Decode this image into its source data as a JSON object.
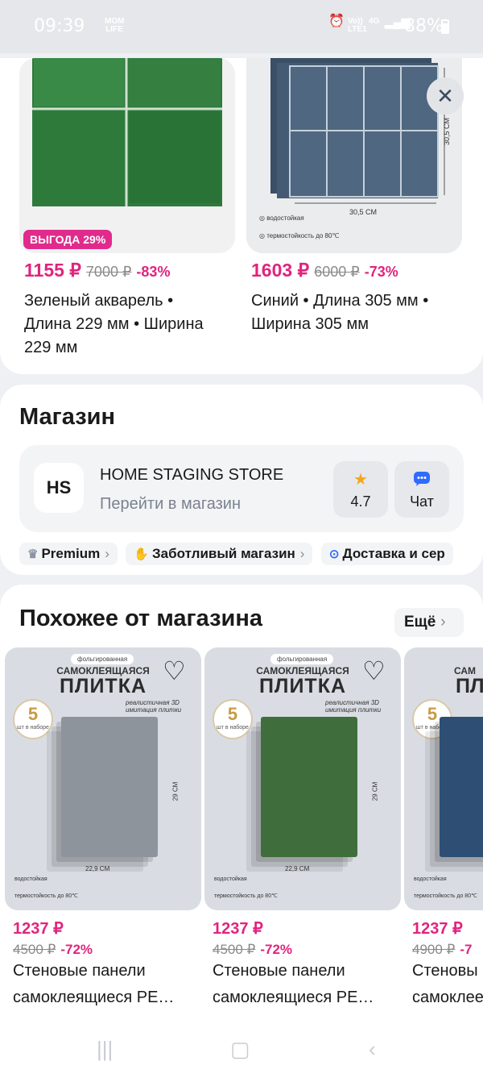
{
  "status_bar": {
    "time": "09:39",
    "carrier_logo": "MOM LIFE",
    "net1": "Vo)) LTE1",
    "net2": "4G",
    "battery": "88%"
  },
  "colors": {
    "accent": "#e0247e",
    "badge": "#e02b8c"
  },
  "products_top": [
    {
      "badge": "ВЫГОДА 29%",
      "price": "1155 ₽",
      "old_price": "7000 ₽",
      "discount": "-83%",
      "line1": "Зеленый акварель •",
      "line2": "Длина 229 мм • Ширина",
      "line3": "229 мм"
    },
    {
      "price": "1603 ₽",
      "old_price": "6000 ₽",
      "discount": "-73%",
      "line1": "Синий • Длина 305 мм •",
      "line2": "Ширина 305 мм",
      "dim_w": "30,5 CM",
      "dim_h": "30,5 CM",
      "feat1": "водостойкая",
      "feat2": "термостойкость до 80℃"
    }
  ],
  "shop": {
    "title": "Магазин",
    "logo": "HS",
    "name": "HOME STAGING STORE",
    "link": "Перейти в магазин",
    "rating": "4.7",
    "chat": "Чат",
    "chips": [
      "Premium",
      "Заботливый магазин",
      "Доставка и сер"
    ]
  },
  "similar": {
    "title": "Похожее от магазина",
    "more": "Ещё",
    "tiles": [
      {
        "tag": "фольгированная",
        "t1": "САМОКЛЕЯЩАЯСЯ",
        "t2": "ПЛИТКА",
        "count": "5",
        "count_unit": "шт в наборе",
        "note": "реалистичная 3D имитация плитки",
        "dim_w": "22,9 CM",
        "dim_h": "29 CM",
        "feat1": "водостойкая",
        "feat2": "термостойкость до 80℃",
        "price": "1237 ₽",
        "old_price": "4500 ₽",
        "discount": "-72%",
        "name1": "Стеновые панели",
        "name2": "самоклеящиеся PE…",
        "panel_color": "#8d949c"
      },
      {
        "tag": "фольгированная",
        "t1": "САМОКЛЕЯЩАЯСЯ",
        "t2": "ПЛИТКА",
        "count": "5",
        "count_unit": "шт в наборе",
        "note": "реалистичная 3D имитация плитки",
        "dim_w": "22,9 CM",
        "dim_h": "29 CM",
        "feat1": "водостойкая",
        "feat2": "термостойкость до 80℃",
        "price": "1237 ₽",
        "old_price": "4500 ₽",
        "discount": "-72%",
        "name1": "Стеновые панели",
        "name2": "самоклеящиеся PE…",
        "panel_color": "#3f6e3c"
      },
      {
        "tag": "",
        "t1": "САМ",
        "t2": "ПЛ",
        "count": "5",
        "count_unit": "шт в наборе",
        "feat1": "водостойкая",
        "feat2": "термостойкость до 80℃",
        "price": "1237 ₽",
        "old_price": "4900 ₽",
        "discount": "-7",
        "name1": "Стеновы",
        "name2": "самоклее",
        "panel_color": "#2e4f73"
      }
    ]
  }
}
